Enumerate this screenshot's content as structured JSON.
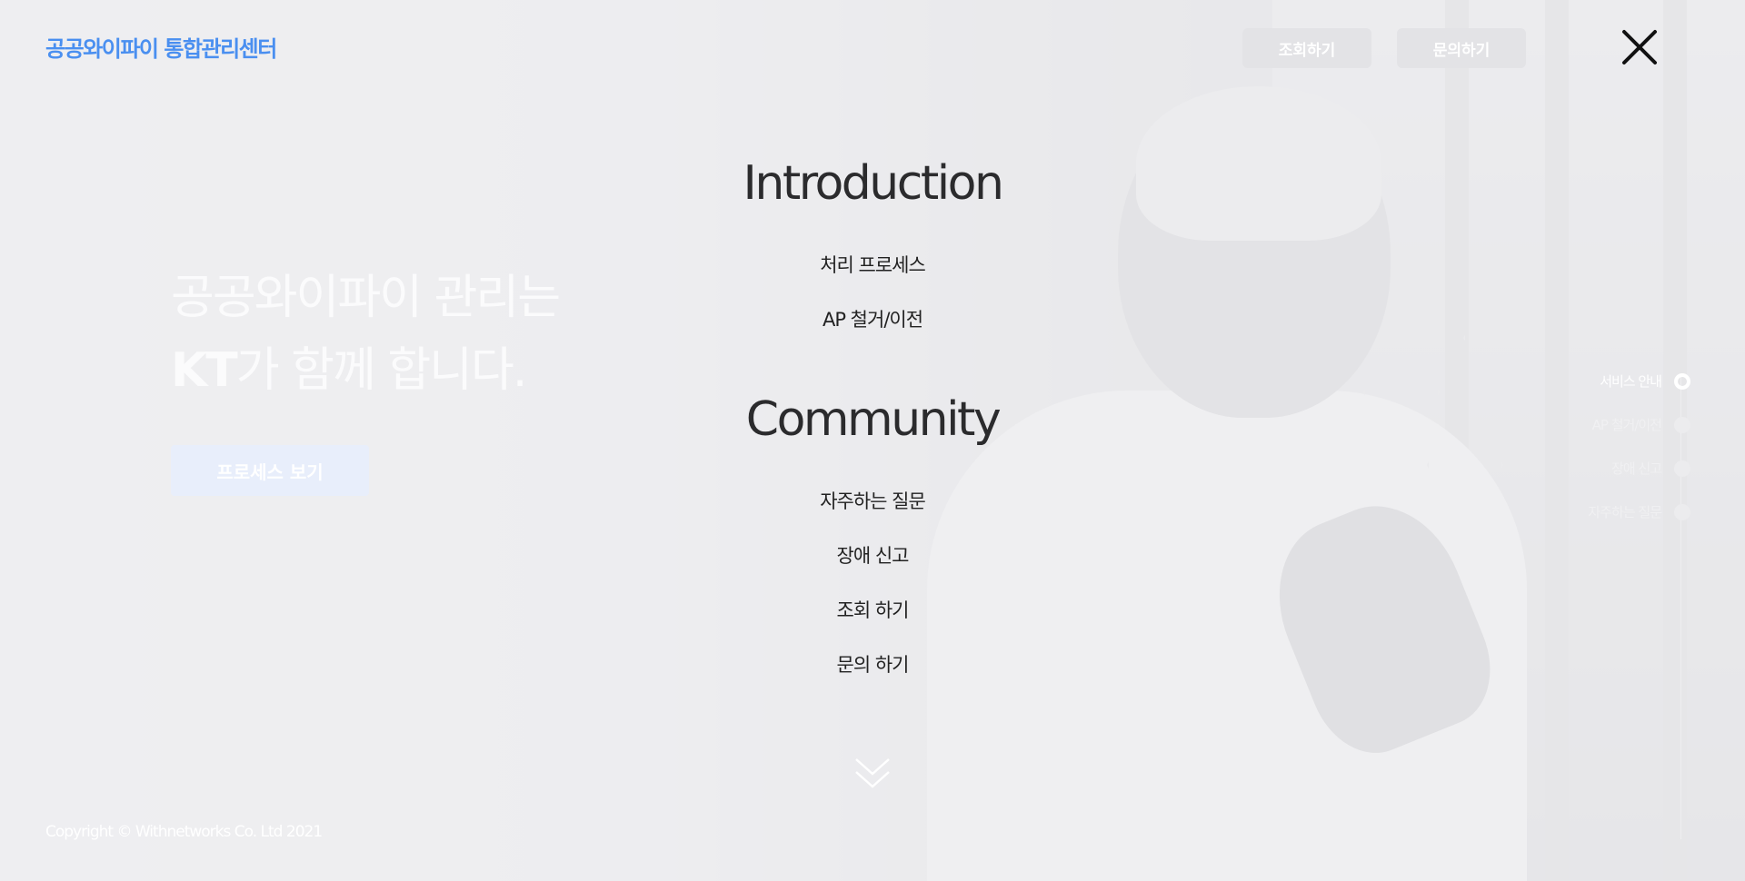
{
  "header": {
    "logo": "공공와이파이 통합관리센터",
    "buttons": [
      "조회하기",
      "문의하기"
    ]
  },
  "hero": {
    "line1": "공공와이파이 관리는",
    "line2_bold": "KT",
    "line2_rest": "가 함께 합니다.",
    "button": "프로세스 보기"
  },
  "menu": {
    "sections": [
      {
        "title": "Introduction",
        "items": [
          "처리 프로세스",
          "AP 철거/이전"
        ]
      },
      {
        "title": "Community",
        "items": [
          "자주하는 질문",
          "장애 신고",
          "조회 하기",
          "문의 하기"
        ]
      }
    ]
  },
  "side_nav": {
    "items": [
      "서비스 안내",
      "AP 철거/이전",
      "장애 신고",
      "자주하는 질문"
    ],
    "active_index": 0
  },
  "footer": {
    "copyright": "Copyright © Withnetworks Co. Ltd 2021"
  },
  "colors": {
    "logo": "#4a8ff0",
    "text_dark": "#2b2b2d",
    "overlay": "#eeeef1"
  }
}
